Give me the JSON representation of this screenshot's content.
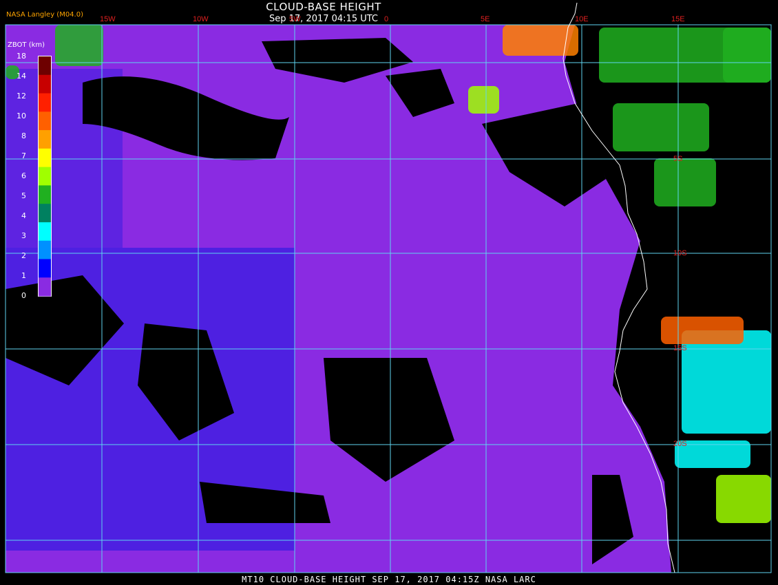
{
  "header": {
    "title": "CLOUD-BASE HEIGHT",
    "timestamp": "Sep 17, 2017 04:15 UTC",
    "producer": "NASA Langley (M04.0)"
  },
  "colorbar": {
    "label": "ZBOT (km)",
    "ticks": [
      "18",
      "14",
      "12",
      "10",
      "8",
      "7",
      "6",
      "5",
      "4",
      "3",
      "2",
      "1",
      "0"
    ],
    "colors": [
      "#6e0000",
      "#c80000",
      "#ff2000",
      "#ff6000",
      "#ffa000",
      "#ffff00",
      "#a0ff00",
      "#20b020",
      "#008060",
      "#00ffff",
      "#0090ff",
      "#0000ff",
      "#8a2be2"
    ]
  },
  "longitude_labels": [
    "15W",
    "10W",
    "5W",
    "0",
    "5E",
    "10E",
    "15E"
  ],
  "latitude_labels": [
    "5S",
    "10S",
    "15S",
    "20S"
  ],
  "footer": "MT10  CLOUD-BASE HEIGHT  SEP 17, 2017 04:15Z  NASA LARC",
  "colors": {
    "background": "#000000",
    "low_cloud": "#8a2be2",
    "grid": "#5fd5f0",
    "coastline": "#ffffff",
    "axis_label": "#e02020"
  }
}
